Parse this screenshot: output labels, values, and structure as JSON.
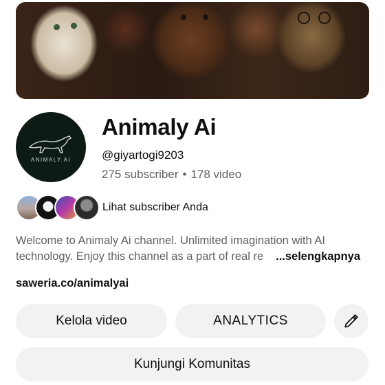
{
  "channel": {
    "name": "Animaly Ai",
    "handle": "@giyartogi9203",
    "subscribers": "275 subscriber",
    "separator": "•",
    "videos": "178 video",
    "avatar_text": "ANIMALY.AI"
  },
  "subscribers_row": {
    "label": "Lihat subscriber Anda"
  },
  "description": {
    "line1": "Welcome to Animaly Ai channel. Unlimited imagination with AI",
    "line2": "technology. Enjoy this channel as a part of real re",
    "more_label": "...selengkapnya"
  },
  "link": "saweria.co/animalyai",
  "buttons": {
    "manage_videos": "Kelola video",
    "analytics": "ANALYTICS",
    "visit_community": "Kunjungi Komunitas"
  },
  "icons": {
    "edit": "pencil-icon"
  },
  "colors": {
    "button_bg": "#f2f2f2",
    "secondary_text": "#606060",
    "avatar_bg": "#0e1a14"
  }
}
